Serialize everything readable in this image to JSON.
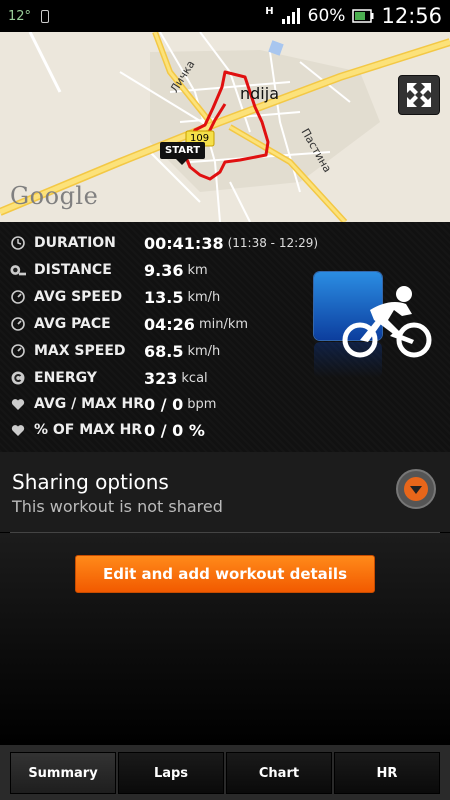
{
  "status_bar": {
    "temperature": "12°",
    "network": "H",
    "battery": "60%",
    "time": "12:56"
  },
  "map": {
    "start_label": "START",
    "road_marker": "109",
    "labels": [
      "Личка",
      "Пастина",
      "ndija"
    ],
    "attribution": "Google"
  },
  "stats": [
    {
      "icon": "clock-icon",
      "label": "DURATION",
      "value": "00:41:38",
      "unit": "",
      "extra": "(11:38 - 12:29)"
    },
    {
      "icon": "distance-icon",
      "label": "DISTANCE",
      "value": "9.36",
      "unit": "km",
      "extra": ""
    },
    {
      "icon": "gauge-icon",
      "label": "AVG SPEED",
      "value": "13.5",
      "unit": "km/h",
      "extra": ""
    },
    {
      "icon": "gauge-icon",
      "label": "AVG PACE",
      "value": "04:26",
      "unit": "min/km",
      "extra": ""
    },
    {
      "icon": "gauge-icon",
      "label": "MAX SPEED",
      "value": "68.5",
      "unit": "km/h",
      "extra": ""
    },
    {
      "icon": "energy-icon",
      "label": "ENERGY",
      "value": "323",
      "unit": "kcal",
      "extra": ""
    },
    {
      "icon": "heart-icon",
      "label": "AVG / MAX HR",
      "value": "0 / 0",
      "unit": "bpm",
      "extra": ""
    },
    {
      "icon": "heart-icon",
      "label": "% OF MAX HR",
      "value": "0 / 0 %",
      "unit": "",
      "extra": ""
    }
  ],
  "sharing": {
    "title": "Sharing options",
    "subtitle": "This workout is not shared"
  },
  "edit_button": "Edit and add workout details",
  "tabs": [
    "Summary",
    "Laps",
    "Chart",
    "HR"
  ],
  "colors": {
    "accent": "#f26c05",
    "route": "#e01010"
  }
}
